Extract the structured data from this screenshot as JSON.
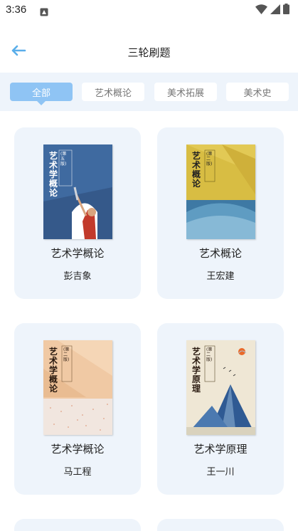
{
  "status": {
    "time": "3:36"
  },
  "header": {
    "title": "三轮刷题"
  },
  "tabs": [
    {
      "label": "全部"
    },
    {
      "label": "艺术概论"
    },
    {
      "label": "美术拓展"
    },
    {
      "label": "美术史"
    }
  ],
  "books": [
    {
      "title": "艺术学概论",
      "author": "彭吉象",
      "cover_text": "艺术学概论",
      "cover_edition": "(第五版)",
      "cover_bg": "#3f6aa0"
    },
    {
      "title": "艺术概论",
      "author": "王宏建",
      "cover_text": "艺术概论",
      "cover_edition": "(第二版)",
      "cover_bg": "#d8bd43"
    },
    {
      "title": "艺术学概论",
      "author": "马工程",
      "cover_text": "艺术学概论",
      "cover_edition": "(第二版)",
      "cover_bg": "#f0c9a4"
    },
    {
      "title": "艺术学原理",
      "author": "王一川",
      "cover_text": "艺术学原理",
      "cover_edition": "(第二版)",
      "cover_bg": "#efe7d5"
    }
  ],
  "colors": {
    "accent": "#8fc4f4",
    "card_bg": "#eef4fb",
    "back_arrow": "#5aaeea"
  }
}
